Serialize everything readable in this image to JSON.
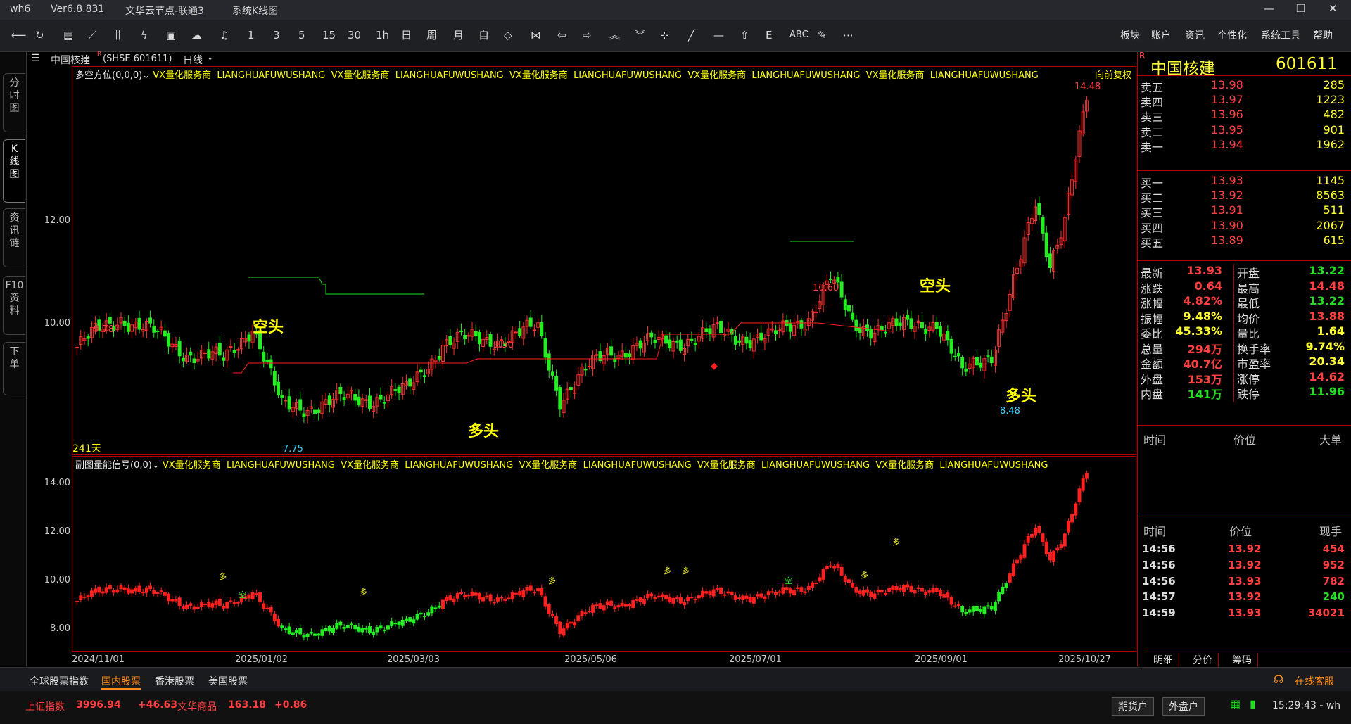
{
  "window": {
    "app": "wh6",
    "version": "Ver6.8.831",
    "server": "文华云节点-联通3",
    "view": "系统K线图"
  },
  "toolbar": {
    "icons": [
      "back-icon",
      "refresh-icon",
      "list-icon",
      "line-chart-icon",
      "candle-icon",
      "flash-icon",
      "screenshot-icon",
      "cloud-icon",
      "bell-icon"
    ],
    "periods": [
      "1",
      "3",
      "5",
      "15",
      "30",
      "1h",
      "日",
      "周",
      "月",
      "自"
    ],
    "draw_icons": [
      "expand-icon",
      "shrink-icon",
      "prev-icon",
      "next-icon",
      "up-icon",
      "down-icon",
      "crosshair-icon",
      "line-tool-icon",
      "hline-icon",
      "home-icon",
      "text-tool-icon",
      "abc-icon",
      "pen-icon",
      "more-icon"
    ],
    "right_menu": [
      "板块",
      "账户",
      "资讯",
      "个性化",
      "系统工具",
      "帮助"
    ]
  },
  "left_tabs": [
    "分\n时\n图",
    "K\n线\n图",
    "资\n讯\n链",
    "F10\n资\n料",
    "下\n单"
  ],
  "info": {
    "symbol": "中国核建",
    "badge": "R",
    "code": "(SHSE 601611)",
    "period": "日线"
  },
  "main": {
    "indicator": "多空方位(0,0,0)",
    "ad": "VX量化服务商  LIANGHUAFUWUSHANG  VX量化服务商  LIANGHUAFUWUSHANG  VX量化服务商  LIANGHUAFUWUSHANG  VX量化服务商  LIANGHUAFUWUSHANG  VX量化服务商  LIANGHUAFUWUSHANG",
    "adjust": "向前复权",
    "days": "241天",
    "labels": {
      "high1": "9.78",
      "low1": "7.75",
      "mid": "9.50",
      "peak1": "10.60",
      "peak2": "14.48",
      "low2": "8.48",
      "kong1": "空头",
      "kong2": "空头",
      "duo1": "多头",
      "duo2": "多头"
    }
  },
  "sub": {
    "indicator": "副图量能信号(0,0)",
    "ad": "VX量化服务商  LIANGHUAFUWUSHANG  VX量化服务商  LIANGHUAFUWUSHANG  VX量化服务商  LIANGHUAFUWUSHANG  VX量化服务商  LIANGHUAFUWUSHANG  VX量化服务商  LIANGHUAFUWUSHANG",
    "duo": "多",
    "kong": "空"
  },
  "yaxis_main": [
    "12.00",
    "10.00"
  ],
  "yaxis_sub": [
    "14.00",
    "12.00",
    "10.00",
    "8.00"
  ],
  "xaxis": [
    "2024/11/01",
    "2025/01/02",
    "2025/03/03",
    "2025/05/06",
    "2025/07/01",
    "2025/09/01",
    "2025/10/27"
  ],
  "chart_data": {
    "type": "candlestick",
    "title": "中国核建 601611 日线",
    "x_labels": [
      "2024/11/01",
      "2025/01/02",
      "2025/03/03",
      "2025/05/06",
      "2025/07/01",
      "2025/09/01",
      "2025/10/27"
    ],
    "annotated_prices": {
      "high_2024_11": 9.78,
      "low_2025_01": 7.75,
      "high_2025_04": 9.5,
      "high_2025_08": 10.6,
      "high_2025_10": 14.48,
      "low_2025_09": 8.48
    },
    "ylim": [
      7.5,
      14.8
    ]
  },
  "quote": {
    "name": "中国核建",
    "code": "601611",
    "badge": "R",
    "asks": [
      {
        "label": "卖五",
        "price": "13.98",
        "vol": "285"
      },
      {
        "label": "卖四",
        "price": "13.97",
        "vol": "1223"
      },
      {
        "label": "卖三",
        "price": "13.96",
        "vol": "482"
      },
      {
        "label": "卖二",
        "price": "13.95",
        "vol": "901"
      },
      {
        "label": "卖一",
        "price": "13.94",
        "vol": "1962"
      }
    ],
    "bids": [
      {
        "label": "买一",
        "price": "13.93",
        "vol": "1145"
      },
      {
        "label": "买二",
        "price": "13.92",
        "vol": "8563"
      },
      {
        "label": "买三",
        "price": "13.91",
        "vol": "511"
      },
      {
        "label": "买四",
        "price": "13.90",
        "vol": "2067"
      },
      {
        "label": "买五",
        "price": "13.89",
        "vol": "615"
      }
    ],
    "stats": [
      [
        "最新",
        "13.93",
        "red",
        "开盘",
        "13.22",
        "green"
      ],
      [
        "涨跌",
        "0.64",
        "red",
        "最高",
        "14.48",
        "red"
      ],
      [
        "涨幅",
        "4.82%",
        "red",
        "最低",
        "13.22",
        "green"
      ],
      [
        "振幅",
        "9.48%",
        "yellow",
        "均价",
        "13.88",
        "red"
      ],
      [
        "委比",
        "45.33%",
        "yellow",
        "量比",
        "1.64",
        "yellow"
      ],
      [
        "总量",
        "294万",
        "red",
        "换手率",
        "9.74%",
        "yellow"
      ],
      [
        "金额",
        "40.7亿",
        "red",
        "市盈率",
        "20.34",
        "yellow"
      ],
      [
        "外盘",
        "153万",
        "red",
        "涨停",
        "14.62",
        "red"
      ],
      [
        "内盘",
        "141万",
        "green",
        "跌停",
        "11.96",
        "green"
      ]
    ],
    "big_header": [
      "时间",
      "价位",
      "大单"
    ],
    "tick_header": [
      "时间",
      "价位",
      "现手"
    ],
    "ticks": [
      [
        "14:56",
        "13.92",
        "454",
        "red"
      ],
      [
        "14:56",
        "13.92",
        "952",
        "red"
      ],
      [
        "14:56",
        "13.93",
        "782",
        "red"
      ],
      [
        "14:57",
        "13.92",
        "240",
        "green"
      ],
      [
        "14:59",
        "13.93",
        "34021",
        "red"
      ]
    ],
    "bottom_tabs": [
      "明细",
      "分价",
      "筹码"
    ]
  },
  "markets": [
    "全球股票指数",
    "国内股票",
    "香港股票",
    "美国股票"
  ],
  "service": "在线客服",
  "status": {
    "idx_name": "上证指数",
    "idx_val": "3996.94",
    "idx_chg": "+46.63",
    "com_name": "文华商品",
    "com_val": "163.18",
    "com_chg": "+0.86",
    "btn1": "期货户",
    "btn2": "外盘户",
    "time": "15:29:43 - wh"
  }
}
